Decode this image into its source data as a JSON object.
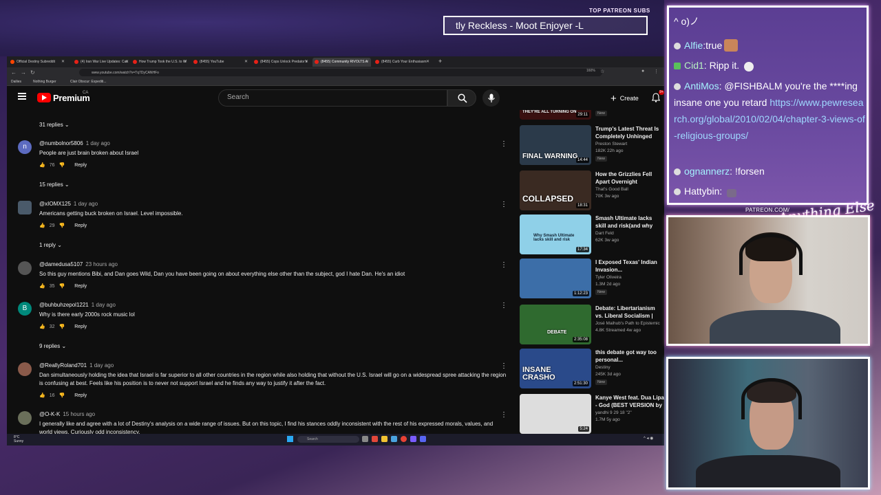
{
  "overlay": {
    "patreon_label": "TOP PATREON SUBS",
    "patreon_marquee": "tly Reckless - Moot Enjoyer -L",
    "patreon_url": "PATREON.COM/",
    "anything_else": "Anything Else"
  },
  "browser": {
    "tabs": [
      {
        "label": "Official Destiny Subreddit",
        "active": false
      },
      {
        "label": "(4) Iran War Live Updates: Cas",
        "active": false
      },
      {
        "label": "How Trump Took the U.S. to W",
        "active": false
      },
      {
        "label": "(8455) YouTube",
        "active": false
      },
      {
        "label": "(8455) Cops Unlock Predator's",
        "active": false
      },
      {
        "label": "(8455) Community RIVOLTS A",
        "active": true
      },
      {
        "label": "(8455) Curb Your Enthusiasm",
        "active": false
      }
    ],
    "url": "www.youtube.com/watch?v=Tq7DyCANHFo",
    "zoom": "160%",
    "bookmarks": [
      "Dailies",
      "Nothing Burger",
      "Clair Obscur: Expediti..."
    ]
  },
  "youtube": {
    "brand": "Premium",
    "country": "CA",
    "search_placeholder": "Search",
    "create_label": "Create",
    "notif_count": "9+"
  },
  "comments": [
    {
      "replies": "31 replies"
    },
    {
      "author": "@numbolnor5806",
      "time": "1 day ago",
      "text": "People are just brain broken about Israel",
      "likes": "76",
      "avatar_letter": "n",
      "avatar_color": "#5c6bc0",
      "replies": "15 replies"
    },
    {
      "author": "@xIOMX125",
      "time": "1 day ago",
      "text": "Americans getting buck broken on Israel. Level impossible.",
      "likes": "29",
      "avatar_letter": "",
      "avatar_color": "#4a5a6a",
      "replies": "1 reply"
    },
    {
      "author": "@damedusa5107",
      "time": "23 hours ago",
      "text": "So this guy mentions Bibi, and Dan goes Wild, Dan you have been going on about everything else other than the subject, god I hate Dan. He's an idiot",
      "likes": "35",
      "avatar_letter": "",
      "avatar_color": "#555555",
      "replies": ""
    },
    {
      "author": "@buhbuhzepol1221",
      "time": "1 day ago",
      "text": "Why is there early 2000s rock music lol",
      "likes": "32",
      "avatar_letter": "B",
      "avatar_color": "#00897b",
      "replies": "9 replies"
    },
    {
      "author": "@ReallyRoland701",
      "time": "1 day ago",
      "text": "Dan simultaneously holding the idea that Israel is far superior to all other countries in the region while also holding that without the U.S. Israel will go on a widespread spree attacking the region is confusing at best. Feels like his position is to never not support Israel and he finds any way to justify it after the fact.",
      "likes": "16",
      "avatar_letter": "",
      "avatar_color": "#8a5a4a",
      "replies": ""
    },
    {
      "author": "@O-K-K",
      "time": "15 hours ago",
      "text": "I generally like and agree with a lot of Destiny's analysis on a wide range of issues. But on this topic, I find his stances oddly inconsistent with the rest of his expressed morals, values, and world views. Curiously odd inconsistency.",
      "likes": "",
      "avatar_letter": "",
      "avatar_color": "#6a6f5a",
      "replies": ""
    }
  ],
  "comment_actions": {
    "reply": "Reply"
  },
  "related": [
    {
      "thumb_text": "THEY'RE ALL TURNING ON",
      "title": "",
      "channel": "",
      "meta": "",
      "duration": "29:11",
      "badge": "New",
      "color": "#3a1010"
    },
    {
      "thumb_text": "FINAL WARNING",
      "title": "Trump's Latest Threat Is Completely Unhinged",
      "channel": "Preston Stewart",
      "meta": "182K  22h ago",
      "duration": "14:44",
      "badge": "New",
      "color": "#2b3a4a"
    },
    {
      "thumb_text": "COLLAPSED",
      "title": "How the Grizzlies Fell Apart Overnight",
      "channel": "That's Good Ball",
      "meta": "70K  3w ago",
      "duration": "18:31",
      "badge": "",
      "color": "#3a2a22"
    },
    {
      "thumb_text": "Why Smash Ultimate lacks skill and risk",
      "title": "Smash Ultimate lacks skill and risk(and why that's a bad thing)",
      "channel": "Dart Feld",
      "meta": "62K  3w ago",
      "duration": "17:34",
      "badge": "",
      "color": "#8fd0e8"
    },
    {
      "thumb_text": "",
      "title": "I Exposed Texas' Indian Invasion...",
      "channel": "Tyler Oliveira",
      "meta": "1.3M  2d ago",
      "duration": "1:12:23",
      "badge": "New",
      "color": "#3c6ea8"
    },
    {
      "thumb_text": "DEBATE",
      "title": "Debate: Libertarianism vs. Liberal Socialism | With M",
      "channel": "José Maihub's Path to Epistemic",
      "meta": "4.8K  Streamed 4w ago",
      "duration": "2:35:08",
      "badge": "",
      "color": "#2f6a2f"
    },
    {
      "thumb_text": "INSANE CRASHO",
      "title": "this debate got way too personal...",
      "channel": "Destiny",
      "meta": "245K  3d ago",
      "duration": "2:51:30",
      "badge": "New",
      "color": "#2a4a8a"
    },
    {
      "thumb_text": "",
      "title": "Kanye West feat. Dua Lipa - God (BEST VERSION by B",
      "channel": "yandhi 9 29 18 \"2\"",
      "meta": "1.7M  5y ago",
      "duration": "5:24",
      "badge": "",
      "color": "#dddddd"
    }
  ],
  "taskbar": {
    "weather_temp": "8°C",
    "weather_desc": "Sunny",
    "search": "Search"
  },
  "chat": [
    {
      "user": "",
      "text": "^ o)ノ"
    },
    {
      "user": "Alfie",
      "text": "true"
    },
    {
      "user": "Cid1",
      "text": "Ripp it."
    },
    {
      "user": "AntiMos",
      "text": "@FISHBALM you're the ****ing insane one you retard",
      "link": "https://www.pewresearch.org/global/2010/02/04/chapter-3-views-of-religious-groups/"
    },
    {
      "user": "ognannerz",
      "text": "!forsen"
    },
    {
      "user": "Hattybin",
      "text": ""
    }
  ]
}
